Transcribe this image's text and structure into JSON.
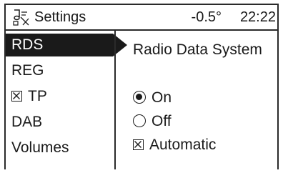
{
  "header": {
    "app_icon": "music-note-settings-icon",
    "title": "Settings",
    "temperature": "-0.5°",
    "time": "22:22"
  },
  "sidebar": {
    "items": [
      {
        "label": "RDS",
        "active": true
      },
      {
        "label": "REG",
        "active": false
      },
      {
        "label": "TP",
        "active": false,
        "checkbox": true,
        "checked": true
      },
      {
        "label": "DAB",
        "active": false
      },
      {
        "label": "Volumes",
        "active": false
      }
    ]
  },
  "content": {
    "title": "Radio Data System",
    "options": [
      {
        "label": "On",
        "type": "radio",
        "checked": true
      },
      {
        "label": "Off",
        "type": "radio",
        "checked": false
      },
      {
        "label": "Automatic",
        "type": "checkbox",
        "checked": true
      }
    ]
  },
  "colors": {
    "foreground": "#1a1a1a",
    "background": "#ffffff",
    "highlight": "#1a1a1a",
    "highlight_text": "#ffffff"
  }
}
